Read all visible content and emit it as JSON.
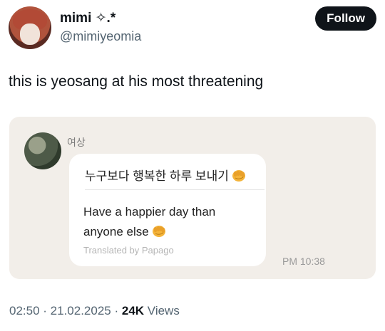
{
  "user": {
    "display_name": "mimi ✧.*",
    "handle": "@mimiyeomia",
    "follow_label": "Follow"
  },
  "tweet": {
    "text": "this is yeosang at his most threatening"
  },
  "message": {
    "sender": "여상",
    "korean_text": "누구보다 행복한 하루 보내기",
    "english_text": "Have a happier day than anyone else",
    "translated_by": "Translated by Papago",
    "time": "PM 10:38",
    "icon": "fist-emoji"
  },
  "meta": {
    "time": "02:50",
    "date": "21.02.2025",
    "views_count": "24K",
    "views_label": "Views"
  },
  "colors": {
    "follow_button": "#0f1419",
    "media_background": "#f2eee9",
    "secondary_text": "#536471"
  }
}
